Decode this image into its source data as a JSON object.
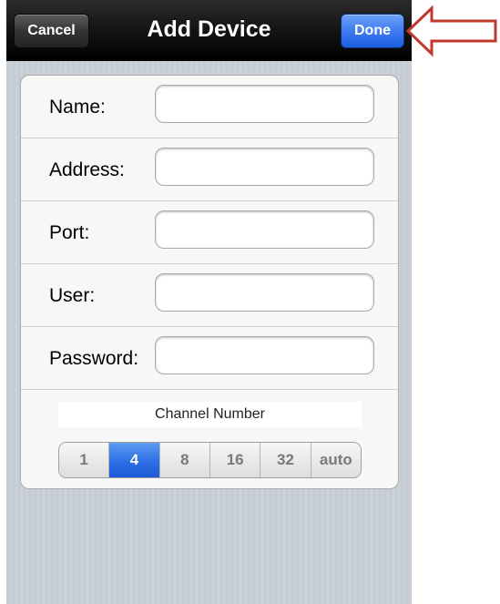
{
  "nav": {
    "title": "Add Device",
    "cancel_label": "Cancel",
    "done_label": "Done"
  },
  "form": {
    "fields": [
      {
        "label": "Name:",
        "value": "",
        "placeholder": ""
      },
      {
        "label": "Address:",
        "value": "",
        "placeholder": ""
      },
      {
        "label": "Port:",
        "value": "",
        "placeholder": ""
      },
      {
        "label": "User:",
        "value": "",
        "placeholder": ""
      },
      {
        "label": "Password:",
        "value": "",
        "placeholder": ""
      }
    ]
  },
  "channel": {
    "label": "Channel Number",
    "options": [
      "1",
      "4",
      "8",
      "16",
      "32",
      "auto"
    ],
    "selected": "4"
  },
  "annotation": {
    "icon": "arrow-left-icon",
    "color": "#c0392b"
  },
  "colors": {
    "done_button": "#3e7cf0",
    "selected_segment": "#2d6ee6",
    "navbar": "#141414"
  }
}
